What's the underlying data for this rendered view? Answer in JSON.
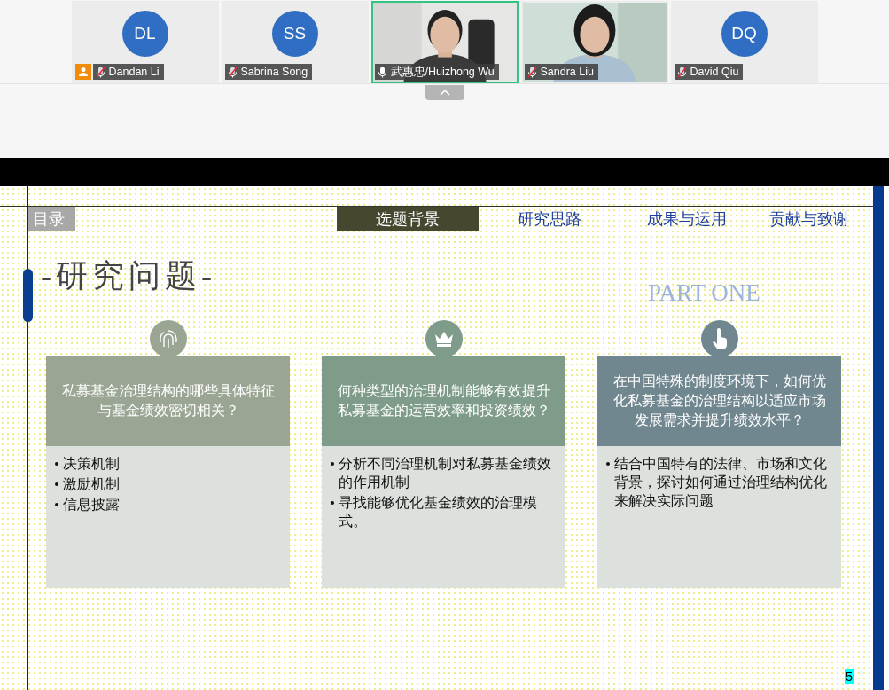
{
  "participants": [
    {
      "kind": "avatar",
      "initials": "DL",
      "name": "Dandan Li",
      "muted": true,
      "badge": true,
      "speaking": false
    },
    {
      "kind": "avatar",
      "initials": "SS",
      "name": "Sabrina Song",
      "muted": true,
      "badge": false,
      "speaking": false
    },
    {
      "kind": "video",
      "name": "武惠忠/Huizhong Wu",
      "muted": false,
      "badge": false,
      "speaking": true
    },
    {
      "kind": "video",
      "name": "Sandra Liu",
      "muted": true,
      "badge": false,
      "speaking": false
    },
    {
      "kind": "avatar",
      "initials": "DQ",
      "name": "David Qiu",
      "muted": true,
      "badge": false,
      "speaking": false
    }
  ],
  "slide": {
    "toc_label": "目录",
    "tabs": [
      {
        "label": "选题背景",
        "selected": true
      },
      {
        "label": "研究思路",
        "selected": false
      },
      {
        "label": "成果与运用",
        "selected": false
      },
      {
        "label": "贡献与致谢",
        "selected": false
      }
    ],
    "title": "-研究问题-",
    "watermark": "PART ONE",
    "cards": [
      {
        "color": "#9aa593",
        "question": "私募基金治理结构的哪些具体特征与基金绩效密切相关？",
        "points": [
          "决策机制",
          "激励机制",
          "信息披露"
        ]
      },
      {
        "color": "#7f9c8a",
        "question": "何种类型的治理机制能够有效提升私募基金的运营效率和投资绩效？",
        "points": [
          "分析不同治理机制对私募基金绩效的作用机制",
          "寻找能够优化基金绩效的治理模式。"
        ]
      },
      {
        "color": "#718790",
        "question": "在中国特殊的制度环境下，如何优化私募基金的治理结构以适应市场发展需求并提升绩效水平？",
        "points": [
          "结合中国特有的法律、市场和文化背景，探讨如何通过治理结构优化来解决实际问题"
        ]
      }
    ],
    "page_number": "5"
  }
}
